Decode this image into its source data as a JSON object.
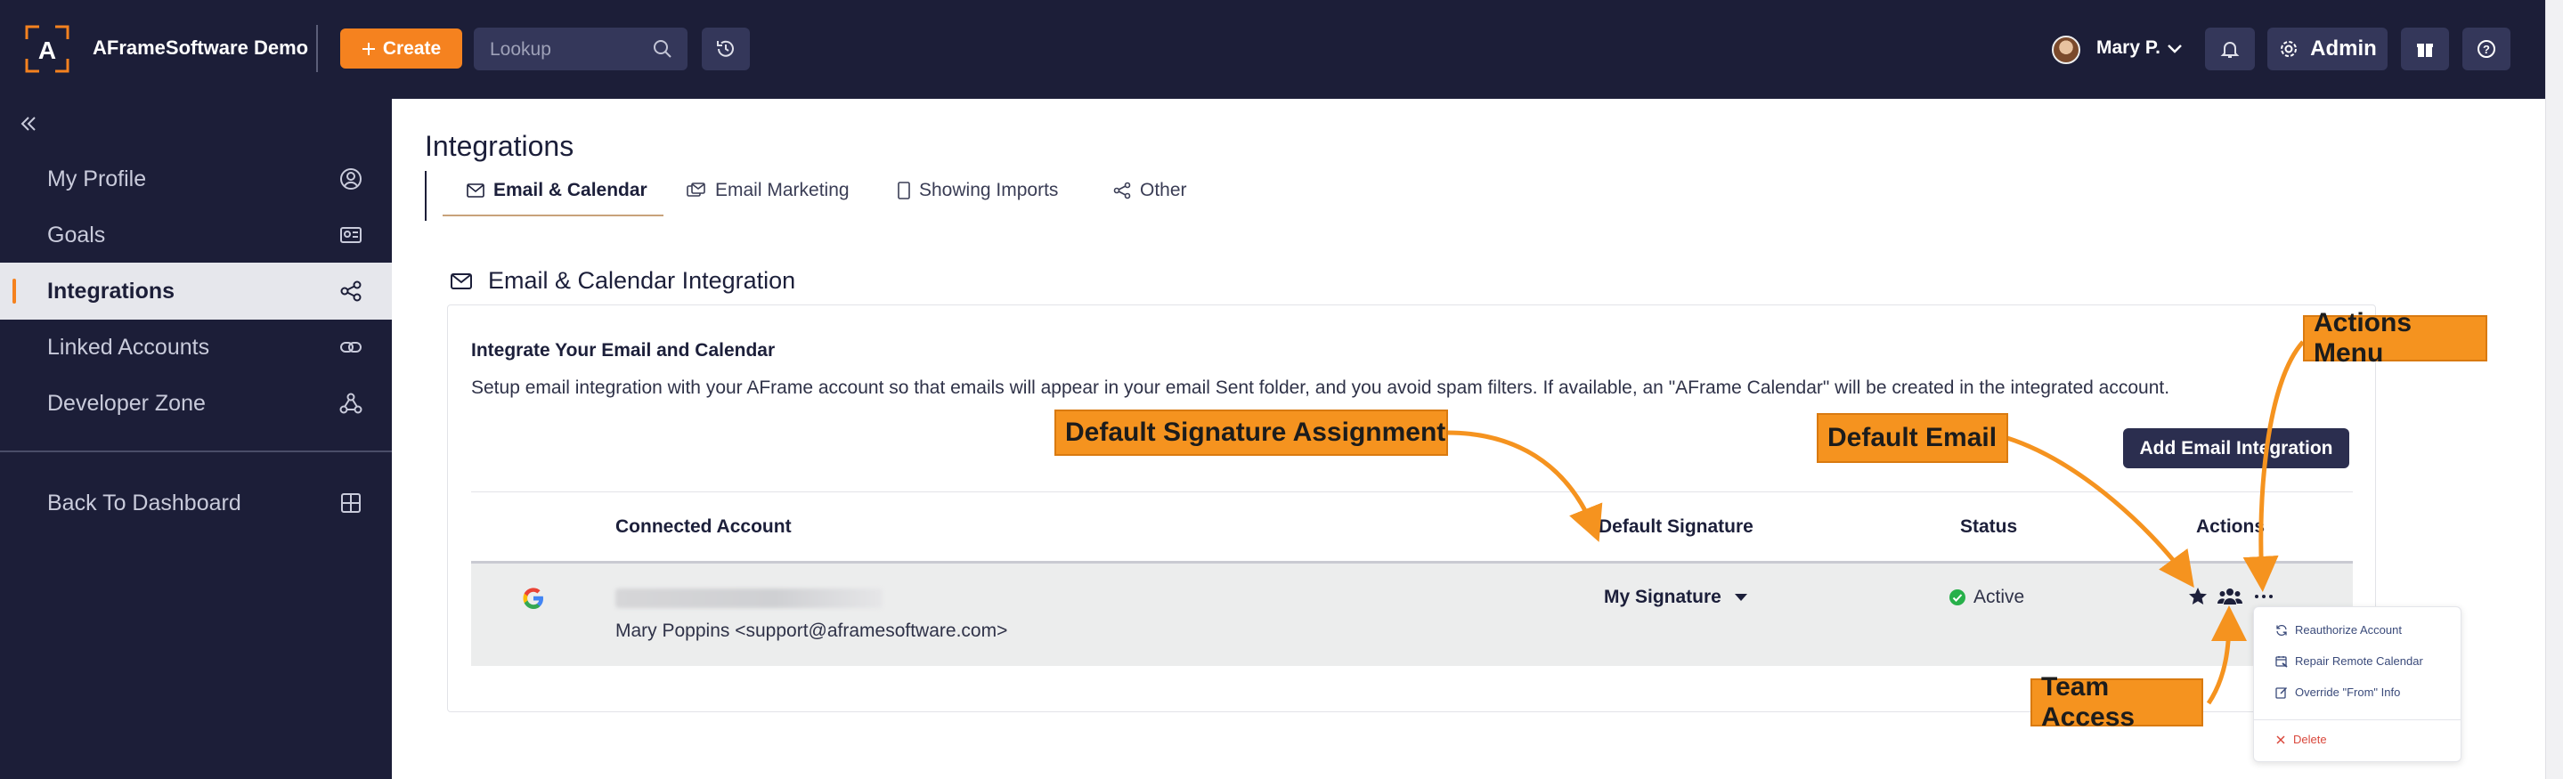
{
  "app": {
    "title": "AFrameSoftware Demo"
  },
  "topbar": {
    "create_label": "Create",
    "search_placeholder": "Lookup",
    "user_name": "Mary P.",
    "admin_label": "Admin"
  },
  "sidebar": {
    "items": [
      {
        "label": "My Profile",
        "icon": "user-circle-icon"
      },
      {
        "label": "Goals",
        "icon": "goals-icon"
      },
      {
        "label": "Integrations",
        "icon": "share-icon",
        "active": true
      },
      {
        "label": "Linked Accounts",
        "icon": "link-icon"
      },
      {
        "label": "Developer Zone",
        "icon": "webhook-icon"
      }
    ],
    "back_label": "Back To Dashboard"
  },
  "main": {
    "title": "Integrations",
    "tabs": [
      {
        "label": "Email & Calendar",
        "icon": "mail-icon",
        "active": true
      },
      {
        "label": "Email Marketing",
        "icon": "mailbox-icon"
      },
      {
        "label": "Showing Imports",
        "icon": "bookmark-icon"
      },
      {
        "label": "Other",
        "icon": "share-icon"
      }
    ],
    "section_title": "Email & Calendar Integration",
    "card": {
      "heading": "Integrate Your Email and Calendar",
      "description": "Setup email integration with your AFrame account so that emails will appear in your email Sent folder, and you avoid spam filters. If available, an \"AFrame Calendar\" will be created in the integrated account.",
      "add_button": "Add Email Integration"
    },
    "table": {
      "columns": [
        "Connected Account",
        "Default Signature",
        "Status",
        "Actions"
      ],
      "rows": [
        {
          "provider": "google-icon",
          "account_name": "Mary Poppins <support@aframesoftware.com>",
          "signature": "My Signature",
          "status": "Active"
        }
      ]
    },
    "actions_menu": [
      {
        "label": "Reauthorize Account",
        "icon": "refresh-icon"
      },
      {
        "label": "Repair Remote Calendar",
        "icon": "calendar-repair-icon"
      },
      {
        "label": "Override \"From\" Info",
        "icon": "edit-icon"
      },
      {
        "label": "Delete",
        "icon": "x-icon",
        "danger": true
      }
    ]
  },
  "annotations": {
    "actions_menu": "Actions Menu",
    "default_signature": "Default Signature Assignment",
    "default_email": "Default Email",
    "team_access": "Team Access"
  },
  "colors": {
    "nav_bg": "#1c1e38",
    "accent": "#f5821f",
    "callout": "#f5931f",
    "button_dark": "#2b2e4f",
    "active_green": "#27b04a",
    "danger": "#d9473b"
  }
}
